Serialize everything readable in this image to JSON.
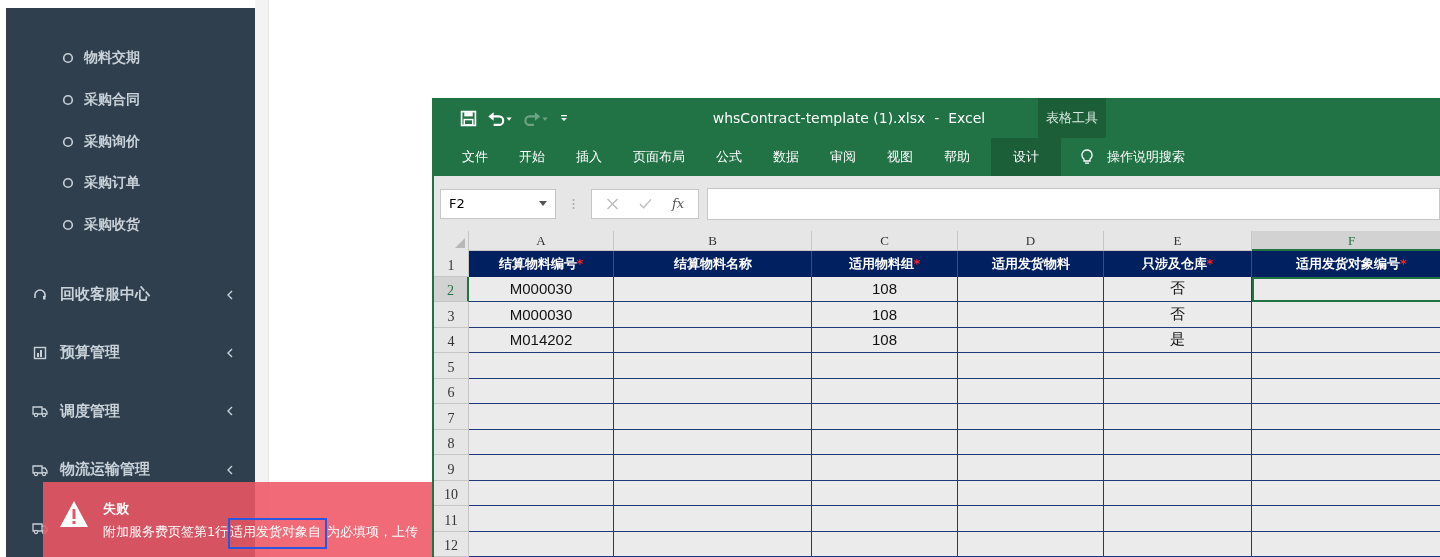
{
  "sidebar": {
    "sub_items": [
      {
        "label": "物料交期"
      },
      {
        "label": "采购合同"
      },
      {
        "label": "采购询价"
      },
      {
        "label": "采购订单"
      },
      {
        "label": "采购收货"
      }
    ],
    "sections": [
      {
        "label": "回收客服中心",
        "kind": "headset"
      },
      {
        "label": "预算管理",
        "kind": "board"
      },
      {
        "label": "调度管理",
        "kind": "truck"
      },
      {
        "label": "物流运输管理",
        "kind": "truck"
      }
    ]
  },
  "excel": {
    "title": "whsContract-template (1).xlsx  -  Excel",
    "context_group": "表格工具",
    "ribbon_tabs": [
      {
        "label": "文件",
        "kind": "normal"
      },
      {
        "label": "开始",
        "kind": "normal"
      },
      {
        "label": "插入",
        "kind": "normal"
      },
      {
        "label": "页面布局",
        "kind": "normal"
      },
      {
        "label": "公式",
        "kind": "normal"
      },
      {
        "label": "数据",
        "kind": "normal"
      },
      {
        "label": "审阅",
        "kind": "normal"
      },
      {
        "label": "视图",
        "kind": "normal"
      },
      {
        "label": "帮助",
        "kind": "normal"
      },
      {
        "label": "设计",
        "kind": "contextual"
      }
    ],
    "search_hint": "操作说明搜索",
    "name_box": "F2",
    "formula_label": "fx",
    "columns": [
      {
        "letter": "A",
        "selected": false
      },
      {
        "letter": "B",
        "selected": false
      },
      {
        "letter": "C",
        "selected": false
      },
      {
        "letter": "D",
        "selected": false
      },
      {
        "letter": "E",
        "selected": false
      },
      {
        "letter": "F",
        "selected": true
      }
    ],
    "header_row": {
      "number": "1",
      "cells": [
        {
          "text": "结算物料编号",
          "mark": "*"
        },
        {
          "text": "结算物料名称"
        },
        {
          "text": "适用物料组",
          "mark": "*"
        },
        {
          "text": "适用发货物料"
        },
        {
          "text": "只涉及仓库",
          "mark": "*"
        },
        {
          "text": "适用发货对象编号",
          "mark": "*"
        }
      ]
    },
    "rows": [
      {
        "number": "2",
        "selected": true,
        "cells": [
          "M000030",
          "",
          "108",
          "",
          "否",
          ""
        ]
      },
      {
        "number": "3",
        "selected": false,
        "cells": [
          "M000030",
          "",
          "108",
          "",
          "否",
          ""
        ]
      },
      {
        "number": "4",
        "selected": false,
        "cells": [
          "M014202",
          "",
          "108",
          "",
          "是",
          ""
        ]
      },
      {
        "number": "5",
        "selected": false,
        "cells": [
          "",
          "",
          "",
          "",
          "",
          ""
        ]
      },
      {
        "number": "6",
        "selected": false,
        "cells": [
          "",
          "",
          "",
          "",
          "",
          ""
        ]
      },
      {
        "number": "7",
        "selected": false,
        "cells": [
          "",
          "",
          "",
          "",
          "",
          ""
        ]
      },
      {
        "number": "8",
        "selected": false,
        "cells": [
          "",
          "",
          "",
          "",
          "",
          ""
        ]
      },
      {
        "number": "9",
        "selected": false,
        "cells": [
          "",
          "",
          "",
          "",
          "",
          ""
        ]
      },
      {
        "number": "10",
        "selected": false,
        "cells": [
          "",
          "",
          "",
          "",
          "",
          ""
        ]
      },
      {
        "number": "11",
        "selected": false,
        "cells": [
          "",
          "",
          "",
          "",
          "",
          ""
        ]
      },
      {
        "number": "12",
        "selected": false,
        "cells": [
          "",
          "",
          "",
          "",
          "",
          ""
        ]
      }
    ]
  },
  "toast": {
    "title": "失败",
    "message": {
      "before": "附加服务费页签第1行",
      "highlighted": "适用发货对象自",
      "after": "为必填项，上传"
    }
  }
}
